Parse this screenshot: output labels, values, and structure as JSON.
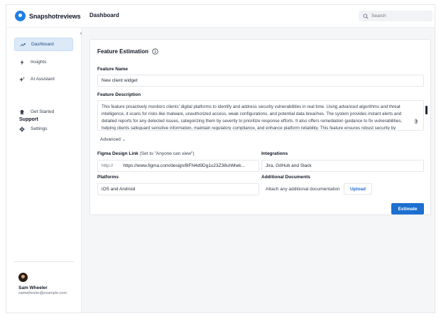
{
  "app": {
    "logo_text": "Snapshotreviews"
  },
  "header": {
    "title": "Dashboard",
    "search_placeholder": "Search"
  },
  "sidebar": {
    "items": [
      {
        "label": "Dashboard",
        "icon": "trending-up-icon",
        "active": true
      },
      {
        "label": "Insights",
        "icon": "lightning-icon"
      },
      {
        "label": "AI Assistant",
        "icon": "sparkles-icon"
      }
    ],
    "support_label": "Support",
    "support_items": [
      {
        "label": "Get Started",
        "icon": "badge-icon"
      },
      {
        "label": "Settings",
        "icon": "gear-icon"
      }
    ],
    "user": {
      "name": "Sam Wheeler",
      "email": "samwheeler@example.com"
    }
  },
  "form": {
    "title": "Feature Estimation",
    "feature_name_label": "Feature Name",
    "feature_name_value": "New client widget",
    "description_label": "Feature Description",
    "description_value": "This feature proactively monitors clients' digital platforms to identify and address security vulnerabilities in real time. Using advanced algorithms and threat intelligence, it scans for risks like malware, unauthorized access, weak configurations, and potential data breaches. The system provides instant alerts and detailed reports for any detected issues, categorizing them by severity to prioritize response efforts. It also offers remediation guidance to fix vulnerabilities, helping clients safeguard sensitive information, maintain regulatory compliance, and enhance platform reliability. This feature ensures robust security by",
    "advanced_label": "Advanced",
    "figma_label": "Figma Design Link",
    "figma_hint": "(Set to \"Anyone can view\")",
    "figma_prefix": "http://",
    "figma_value": "https://www.figma.com/design/BFN4d9Dg1u23Z38uhMwk...",
    "integrations_label": "Integrations",
    "integrations_value": "Jira, GitHub and Slack",
    "platforms_label": "Platforms",
    "platforms_value": "iOS and Android",
    "additional_docs_label": "Additional Documents",
    "attach_text": "Attach any additional documentation",
    "upload_label": "Upload",
    "estimate_label": "Estimate"
  },
  "colors": {
    "accent": "#1d6fd0",
    "active_nav_bg": "#dceaf8"
  }
}
